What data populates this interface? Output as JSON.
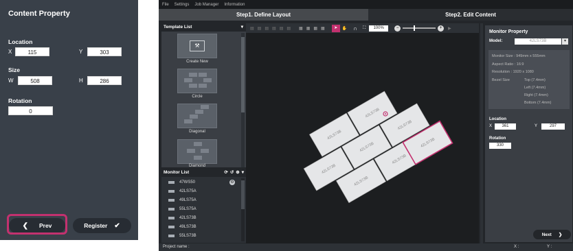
{
  "left_panel": {
    "title": "Content Property",
    "location_label": "Location",
    "x_label": "X",
    "x_value": "115",
    "y_label": "Y",
    "y_value": "303",
    "size_label": "Size",
    "w_label": "W",
    "w_value": "508",
    "h_label": "H",
    "h_value": "286",
    "rotation_label": "Rotation",
    "rotation_value": "0",
    "prev_label": "Prev",
    "register_label": "Register",
    "highlight_color": "#c3316f"
  },
  "app": {
    "menu": [
      "File",
      "Settings",
      "Job Manager",
      "Information"
    ],
    "step1_label": "Step1. Define Layout",
    "step2_label": "Step2. Edit Content",
    "template_list": {
      "header": "Template List",
      "items": [
        "Create New",
        "Circle",
        "Diagonal",
        "Diamond"
      ]
    },
    "monitor_list": {
      "header": "Monitor List",
      "items": [
        "47WS50",
        "42LS75A",
        "49LS75A",
        "55LS75A",
        "42LS73B",
        "49LS73B",
        "55LS73B"
      ]
    },
    "toolbar": {
      "zoom": "100%"
    },
    "canvas_monitors": [
      "42LS73B",
      "42LS73B",
      "42LS73B",
      "42LS73B",
      "42LS73B",
      "42LS73B",
      "42LS73B",
      "42LS73B"
    ],
    "monitor_property": {
      "header": "Monitor Property",
      "model_label": "Model:",
      "model_value": "42LS73B",
      "monitor_size": "Monitor Size : 949mm x 555mm",
      "aspect_ratio": "Aspect Ratio : 16:9",
      "resolution": "Resolution : 1920 x 1080",
      "bezel_label": "Bezel Size",
      "bezel_top": "Top (7.4mm)",
      "bezel_left": "Left (7.4mm)",
      "bezel_right": "Right (7.4mm)",
      "bezel_bottom": "Bottom (7.4mm)",
      "location_label": "Location",
      "x_label": "X",
      "x_value": "361",
      "y_label": "Y",
      "y_value": "297",
      "rotation_label": "Rotation",
      "rotation_value": "330",
      "next_label": "Next"
    },
    "status": {
      "project_label": "Project name :",
      "x_label": "X :",
      "y_label": "Y :"
    }
  }
}
